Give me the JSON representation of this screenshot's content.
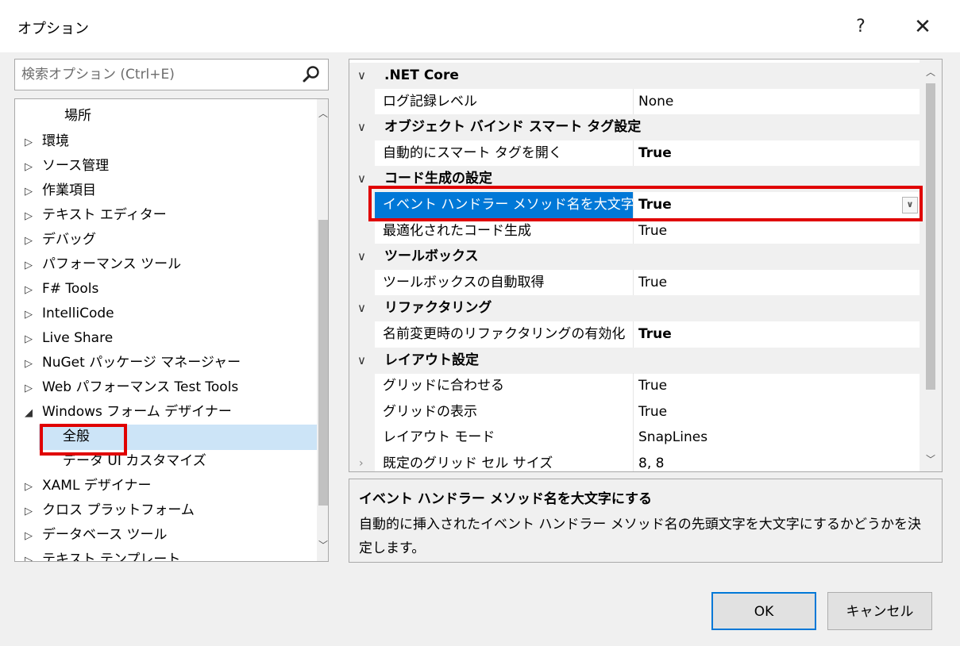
{
  "window": {
    "title": "オプション",
    "help_label": "?",
    "close_label": "✕"
  },
  "search": {
    "placeholder": "検索オプション (Ctrl+E)"
  },
  "tree": {
    "section_label": "場所",
    "items": [
      {
        "arrow": "▷",
        "label": "環境"
      },
      {
        "arrow": "▷",
        "label": "ソース管理"
      },
      {
        "arrow": "▷",
        "label": "作業項目"
      },
      {
        "arrow": "▷",
        "label": "テキスト エディター"
      },
      {
        "arrow": "▷",
        "label": "デバッグ"
      },
      {
        "arrow": "▷",
        "label": "パフォーマンス ツール"
      },
      {
        "arrow": "▷",
        "label": "F# Tools"
      },
      {
        "arrow": "▷",
        "label": "IntelliCode"
      },
      {
        "arrow": "▷",
        "label": "Live Share"
      },
      {
        "arrow": "▷",
        "label": "NuGet パッケージ マネージャー"
      },
      {
        "arrow": "▷",
        "label": "Web パフォーマンス Test Tools"
      },
      {
        "arrow": "◢",
        "label": "Windows フォーム デザイナー"
      },
      {
        "label": "全般",
        "selected": true
      },
      {
        "label": "データ UI カスタマイズ"
      },
      {
        "arrow": "▷",
        "label": "XAML デザイナー"
      },
      {
        "arrow": "▷",
        "label": "クロス プラットフォーム"
      },
      {
        "arrow": "▷",
        "label": "データベース ツール"
      },
      {
        "arrow": "▷",
        "label": "テキスト テンプレート"
      }
    ]
  },
  "grid": {
    "rows": [
      {
        "kind": "category",
        "label": ".NET Core"
      },
      {
        "kind": "prop",
        "name": "ログ記録レベル",
        "value": "None",
        "bold": false
      },
      {
        "kind": "category",
        "label": "オブジェクト バインド スマート タグ設定"
      },
      {
        "kind": "prop",
        "name": "自動的にスマート タグを開く",
        "value": "True",
        "bold": true
      },
      {
        "kind": "category",
        "label": "コード生成の設定"
      },
      {
        "kind": "prop",
        "name": "イベント ハンドラー メソッド名を大文字",
        "value": "True",
        "bold": true,
        "selected": true
      },
      {
        "kind": "prop",
        "name": "最適化されたコード生成",
        "value": "True",
        "bold": false
      },
      {
        "kind": "category",
        "label": "ツールボックス"
      },
      {
        "kind": "prop",
        "name": "ツールボックスの自動取得",
        "value": "True",
        "bold": false
      },
      {
        "kind": "category",
        "label": "リファクタリング"
      },
      {
        "kind": "prop",
        "name": "名前変更時のリファクタリングの有効化",
        "value": "True",
        "bold": true
      },
      {
        "kind": "category",
        "label": "レイアウト設定"
      },
      {
        "kind": "prop",
        "name": "グリッドに合わせる",
        "value": "True",
        "bold": false
      },
      {
        "kind": "prop",
        "name": "グリッドの表示",
        "value": "True",
        "bold": false
      },
      {
        "kind": "prop",
        "name": "レイアウト モード",
        "value": "SnapLines",
        "bold": false
      },
      {
        "kind": "prop",
        "name": "既定のグリッド セル サイズ",
        "value": "8, 8",
        "bold": false,
        "expandable": true
      }
    ]
  },
  "description": {
    "title": "イベント ハンドラー メソッド名を大文字にする",
    "text": "自動的に挿入されたイベント ハンドラー メソッド名の先頭文字を大文字にするかどうかを決定します。"
  },
  "buttons": {
    "ok": "OK",
    "cancel": "キャンセル"
  }
}
